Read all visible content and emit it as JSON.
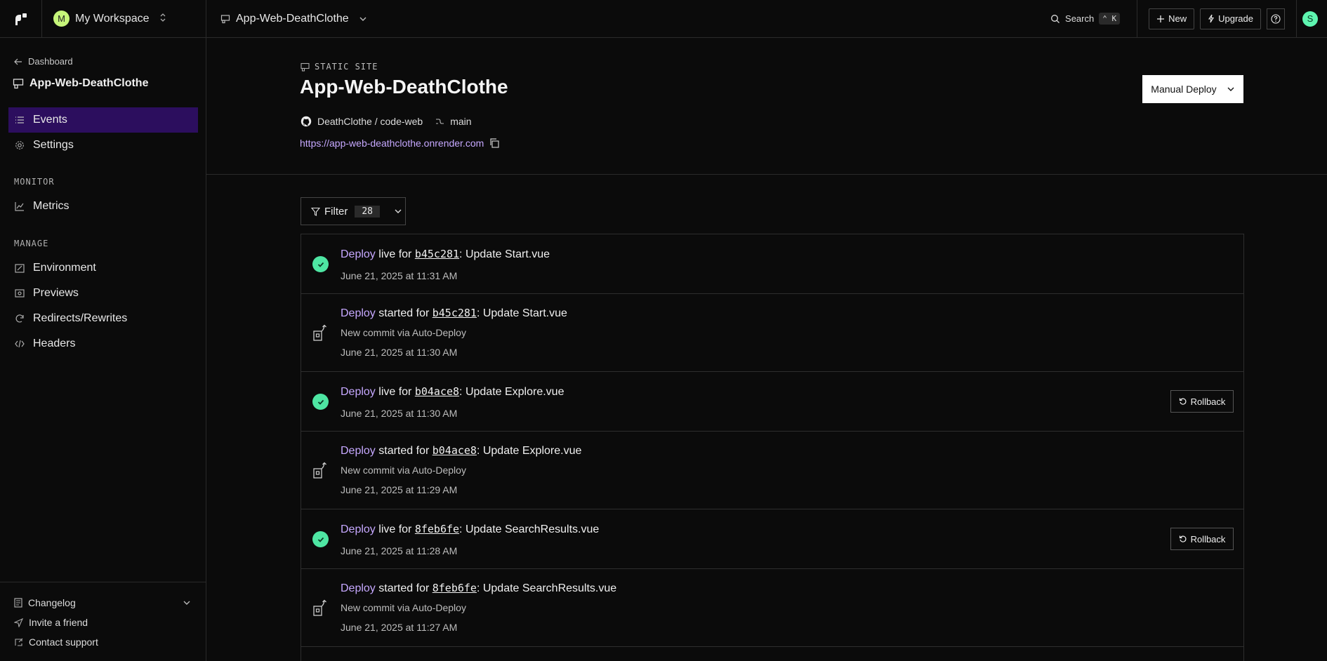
{
  "topbar": {
    "workspace_initial": "M",
    "workspace_name": "My Workspace",
    "service_name": "App-Web-DeathClothe",
    "search_label": "Search",
    "search_shortcut": "⌃ K",
    "new_label": "New",
    "upgrade_label": "Upgrade",
    "user_initial": "S"
  },
  "sidebar": {
    "back_label": "Dashboard",
    "service_title": "App-Web-DeathClothe",
    "primary": [
      {
        "label": "Events"
      },
      {
        "label": "Settings"
      }
    ],
    "monitor_label": "MONITOR",
    "monitor_items": [
      {
        "label": "Metrics"
      }
    ],
    "manage_label": "MANAGE",
    "manage_items": [
      {
        "label": "Environment"
      },
      {
        "label": "Previews"
      },
      {
        "label": "Redirects/Rewrites"
      },
      {
        "label": "Headers"
      }
    ],
    "bottom": [
      {
        "label": "Changelog"
      },
      {
        "label": "Invite a friend"
      },
      {
        "label": "Contact support"
      }
    ]
  },
  "header": {
    "kind": "STATIC SITE",
    "title": "App-Web-DeathClothe",
    "repo": "DeathClothe / code-web",
    "branch": "main",
    "url": "https://app-web-deathclothe.onrender.com",
    "manual_deploy_label": "Manual Deploy"
  },
  "filter": {
    "label": "Filter",
    "count": "28"
  },
  "events": [
    {
      "link": "Deploy",
      "status": " live for ",
      "hash": "b45c281",
      "message": ": Update Start.vue",
      "sub": "",
      "time": "June 21, 2025 at 11:31 AM"
    },
    {
      "link": "Deploy",
      "status": " started for ",
      "hash": "b45c281",
      "message": ": Update Start.vue",
      "sub": "New commit via Auto-Deploy",
      "time": "June 21, 2025 at 11:30 AM"
    },
    {
      "link": "Deploy",
      "status": " live for ",
      "hash": "b04ace8",
      "message": ": Update Explore.vue",
      "sub": "",
      "time": "June 21, 2025 at 11:30 AM",
      "rollback": "Rollback"
    },
    {
      "link": "Deploy",
      "status": " started for ",
      "hash": "b04ace8",
      "message": ": Update Explore.vue",
      "sub": "New commit via Auto-Deploy",
      "time": "June 21, 2025 at 11:29 AM"
    },
    {
      "link": "Deploy",
      "status": " live for ",
      "hash": "8feb6fe",
      "message": ": Update SearchResults.vue",
      "sub": "",
      "time": "June 21, 2025 at 11:28 AM",
      "rollback": "Rollback"
    },
    {
      "link": "Deploy",
      "status": " started for ",
      "hash": "8feb6fe",
      "message": ": Update SearchResults.vue",
      "sub": "New commit via Auto-Deploy",
      "time": "June 21, 2025 at 11:27 AM"
    }
  ],
  "colors": {
    "accent": "#c6a8ff",
    "active_nav": "#2c0e5e",
    "success": "#4ee6a3"
  }
}
